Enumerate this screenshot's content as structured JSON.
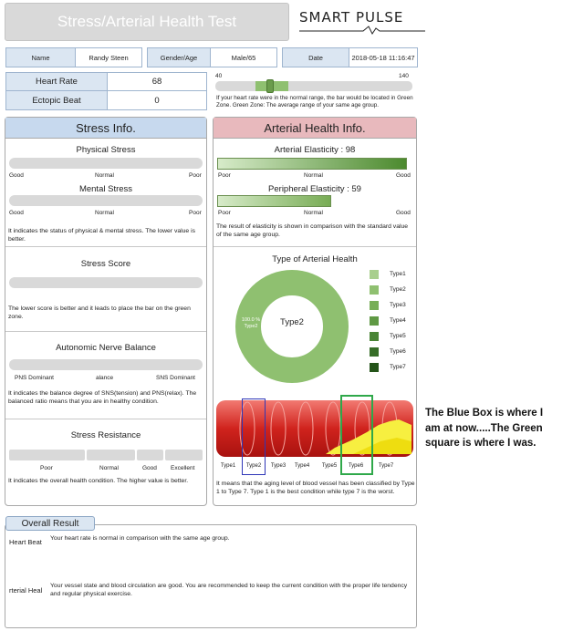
{
  "app": {
    "title": "Stress/Arterial Health Test",
    "logo": "SMART PULSE"
  },
  "patient": {
    "name_label": "Name",
    "name_value": "Randy Steen",
    "gender_age_label": "Gender/Age",
    "gender_age_value": "Male/65",
    "date_label": "Date",
    "date_value": "2018-05-18 11:16:47"
  },
  "vitals": {
    "heart_rate_label": "Heart Rate",
    "heart_rate_value": "68",
    "ectopic_label": "Ectopic Beat",
    "ectopic_value": "0",
    "range_min": "40",
    "range_max": "140",
    "heart_rate_numeric": 68,
    "heart_rate_desc": "If your heart rate were in the normal range, the bar would be located in Green Zone. Green Zone: The average range of your same age group."
  },
  "stress": {
    "header": "Stress Info.",
    "physical_title": "Physical Stress",
    "mental_title": "Mental Stress",
    "scale_good": "Good",
    "scale_normal": "Normal",
    "scale_poor": "Poor",
    "status_desc": "It indicates the status of physical & mental stress. The lower value is better.",
    "score_title": "Stress Score",
    "score_desc": "The lower score is better and it leads to place the bar on the green zone.",
    "ans_title": "Autonomic Nerve Balance",
    "ans_left": "PNS Dominant",
    "ans_mid": "alance",
    "ans_right": "SNS Dominant",
    "ans_desc": "It indicates the balance degree of SNS(tension) and PNS(relax). The balanced ratio means that you are in healthy condition.",
    "resistance_title": "Stress Resistance",
    "res_poor": "Poor",
    "res_normal": "Normal",
    "res_good": "Good",
    "res_excellent": "Excellent",
    "resistance_desc": "It indicates the overall health condition. The higher value is better."
  },
  "arterial": {
    "header": "Arterial Health Info.",
    "elasticity_title": "Arterial Elasticity : 98",
    "elasticity_value": 98,
    "peripheral_title": "Peripheral Elasticity : 59",
    "peripheral_value": 59,
    "scale_poor": "Poor",
    "scale_normal": "Normal",
    "scale_good": "Good",
    "elasticity_desc": "The result of elasticity is shown in comparison with the standard value of the same age group.",
    "type_title": "Type of Arterial Health",
    "donut_center": "Type2",
    "donut_pct": "100.0 %",
    "donut_type": "Type2",
    "legend": [
      {
        "label": "Type1",
        "color": "#a9cf8e"
      },
      {
        "label": "Type2",
        "color": "#8fc070"
      },
      {
        "label": "Type3",
        "color": "#77ae57"
      },
      {
        "label": "Type4",
        "color": "#5f9944"
      },
      {
        "label": "Type5",
        "color": "#4a8435"
      },
      {
        "label": "Type6",
        "color": "#366d27"
      },
      {
        "label": "Type7",
        "color": "#245419"
      }
    ],
    "types": [
      "Type1",
      "Type2",
      "Type3",
      "Type4",
      "Type5",
      "Type6",
      "Type7"
    ],
    "type_desc": "It means that the aging level of blood vessel has been classified by Type 1 to Type 7. Type 1 is the best condition while type 7 is the worst."
  },
  "annotation": {
    "line1": "The Blue Box is where I",
    "line2": "am at now.....The Green",
    "line3": "square is where I was."
  },
  "overall": {
    "tab": "Overall Result",
    "row1_label": "Heart Beat",
    "row1_text": "Your heart rate is normal in comparison with the same age group.",
    "row2_label": "rterial Heal",
    "row2_text": "Your vessel state and blood circulation are good. You are recommended to keep the current condition with the proper life tendency and regular physical exercise."
  }
}
